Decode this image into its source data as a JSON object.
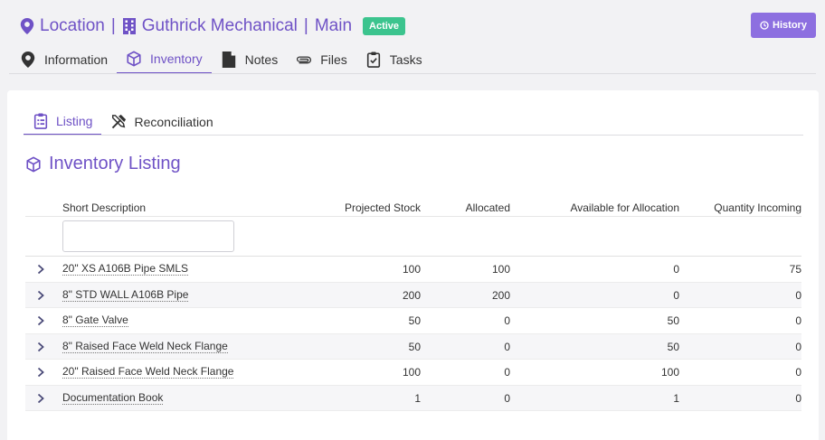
{
  "header": {
    "title_location": "Location",
    "title_company": "Guthrick Mechanical",
    "title_site": "Main",
    "status_badge": "Active",
    "history_label": "History",
    "colors": {
      "accent": "#6f52c6",
      "badge": "#3cc48e",
      "button": "#8d6fe0"
    }
  },
  "tabs": [
    {
      "label": "Information",
      "icon": "map-pin-icon"
    },
    {
      "label": "Inventory",
      "icon": "box-icon",
      "active": true
    },
    {
      "label": "Notes",
      "icon": "note-icon"
    },
    {
      "label": "Files",
      "icon": "paperclip-icon"
    },
    {
      "label": "Tasks",
      "icon": "clipboard-check-icon"
    }
  ],
  "subtabs": [
    {
      "label": "Listing",
      "icon": "clipboard-list-icon",
      "active": true
    },
    {
      "label": "Reconciliation",
      "icon": "tools-icon"
    }
  ],
  "section_title": "Inventory Listing",
  "table": {
    "columns": [
      "Short Description",
      "Projected Stock",
      "Allocated",
      "Available for Allocation",
      "Quantity Incoming"
    ],
    "filter_placeholder": "",
    "rows": [
      {
        "desc": "20\" XS A106B Pipe SMLS",
        "projected": "100",
        "allocated": "100",
        "available": "0",
        "incoming": "75"
      },
      {
        "desc": "8\" STD WALL A106B Pipe",
        "projected": "200",
        "allocated": "200",
        "available": "0",
        "incoming": "0"
      },
      {
        "desc": "8\" Gate Valve",
        "projected": "50",
        "allocated": "0",
        "available": "50",
        "incoming": "0"
      },
      {
        "desc": "8\" Raised Face Weld Neck Flange",
        "projected": "50",
        "allocated": "0",
        "available": "50",
        "incoming": "0"
      },
      {
        "desc": "20\" Raised Face Weld Neck Flange",
        "projected": "100",
        "allocated": "0",
        "available": "100",
        "incoming": "0"
      },
      {
        "desc": "Documentation Book",
        "projected": "1",
        "allocated": "0",
        "available": "1",
        "incoming": "0"
      }
    ]
  }
}
